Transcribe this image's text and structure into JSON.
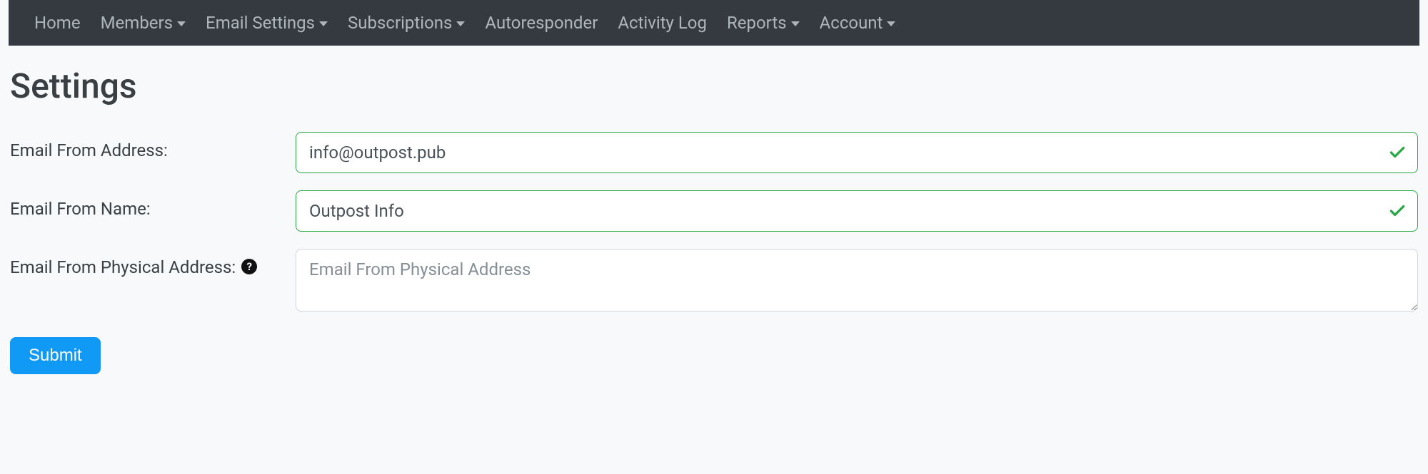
{
  "nav": {
    "items": [
      {
        "label": "Home",
        "dropdown": false
      },
      {
        "label": "Members",
        "dropdown": true
      },
      {
        "label": "Email Settings",
        "dropdown": true
      },
      {
        "label": "Subscriptions",
        "dropdown": true
      },
      {
        "label": "Autoresponder",
        "dropdown": false
      },
      {
        "label": "Activity Log",
        "dropdown": false
      },
      {
        "label": "Reports",
        "dropdown": true
      },
      {
        "label": "Account",
        "dropdown": true
      }
    ]
  },
  "page": {
    "title": "Settings"
  },
  "form": {
    "email_from_address": {
      "label": "Email From Address:",
      "value": "info@outpost.pub"
    },
    "email_from_name": {
      "label": "Email From Name:",
      "value": "Outpost Info"
    },
    "email_from_physical_address": {
      "label": "Email From Physical Address:",
      "placeholder": "Email From Physical Address",
      "value": ""
    },
    "submit_label": "Submit",
    "help_tooltip": "?"
  }
}
